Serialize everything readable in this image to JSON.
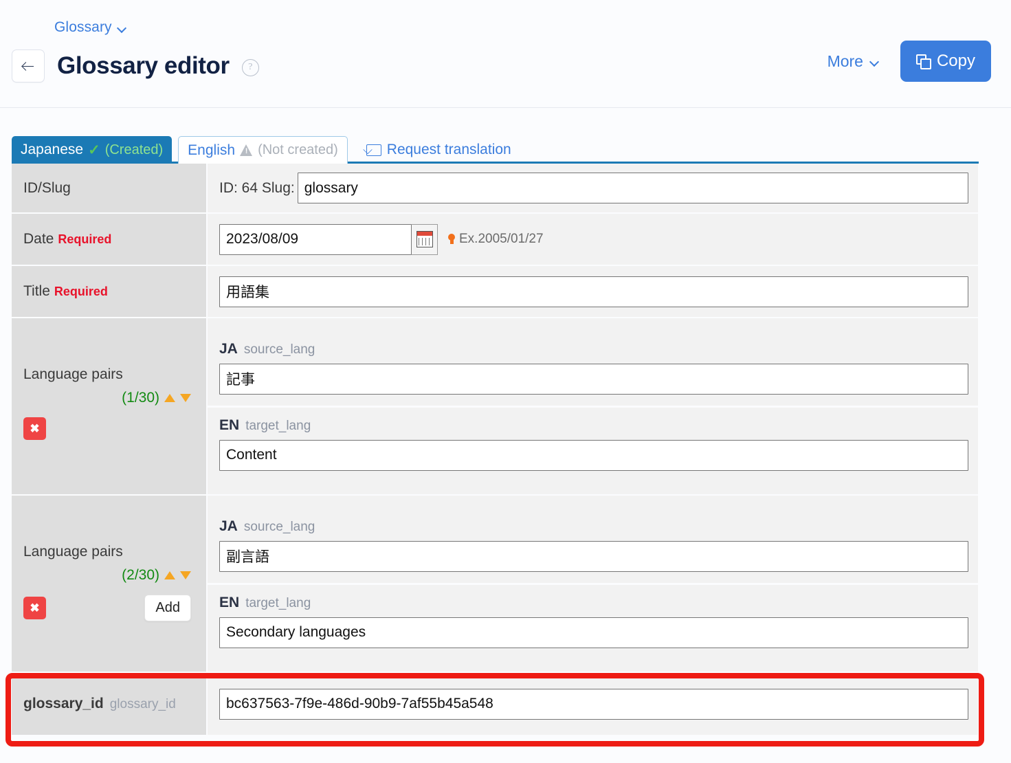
{
  "header": {
    "breadcrumb": "Glossary",
    "breadcrumb_caret_icon": "chevron-down-icon",
    "back_icon": "arrow-left-icon",
    "title": "Glossary editor",
    "help_icon": "question-circle-icon",
    "more_label": "More",
    "more_caret_icon": "chevron-down-icon",
    "copy_label": "Copy",
    "copy_icon": "copy-icon",
    "accent_color": "#3b7ddd"
  },
  "tabs": {
    "japanese": {
      "label": "Japanese",
      "status": "(Created)",
      "status_icon": "check-icon",
      "active": true,
      "bg_color": "#1b7ab5",
      "status_color": "#8fe38f"
    },
    "english": {
      "label": "English",
      "status": "(Not created)",
      "status_icon": "warning-triangle-icon",
      "active": false,
      "status_color": "#aab0b8"
    },
    "request_translation": {
      "label": "Request translation",
      "icon": "mail-icon"
    }
  },
  "form": {
    "id_slug": {
      "label": "ID/Slug",
      "prefix": "ID: 64 Slug:",
      "value": "glossary"
    },
    "date": {
      "label": "Date",
      "required": "Required",
      "value": "2023/08/09",
      "calendar_icon": "calendar-icon",
      "hint_icon": "lightbulb-icon",
      "hint": "Ex.2005/01/27"
    },
    "title": {
      "label": "Title",
      "required": "Required",
      "value": "用語集"
    },
    "language_pairs": [
      {
        "label": "Language pairs",
        "count": "(1/30)",
        "move_up_icon": "triangle-up-icon",
        "move_down_icon": "triangle-down-icon",
        "delete_icon": "close-x-icon",
        "add_label": "",
        "source": {
          "code": "JA",
          "key": "source_lang",
          "value": "記事"
        },
        "target": {
          "code": "EN",
          "key": "target_lang",
          "value": "Content"
        }
      },
      {
        "label": "Language pairs",
        "count": "(2/30)",
        "move_up_icon": "triangle-up-icon",
        "move_down_icon": "triangle-down-icon",
        "delete_icon": "close-x-icon",
        "add_label": "Add",
        "source": {
          "code": "JA",
          "key": "source_lang",
          "value": "副言語"
        },
        "target": {
          "code": "EN",
          "key": "target_lang",
          "value": "Secondary languages"
        }
      }
    ],
    "glossary_id": {
      "label": "glossary_id",
      "key": "glossary_id",
      "value": "bc637563-7f9e-486d-90b9-7af55b45a548",
      "highlight_color": "#ee1c14"
    }
  }
}
